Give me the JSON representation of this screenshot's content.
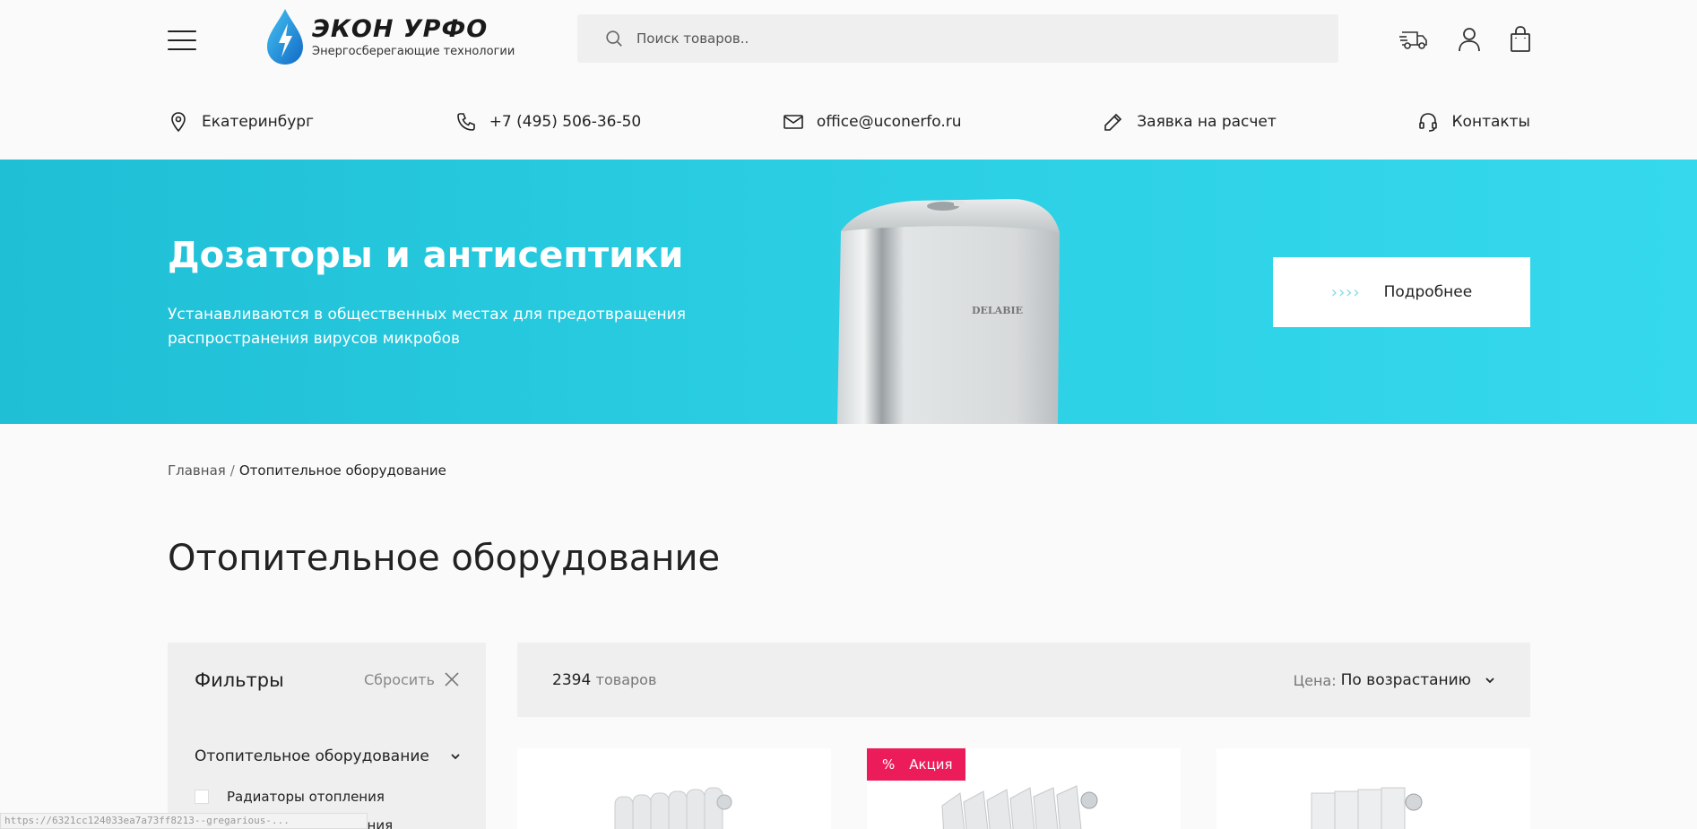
{
  "header": {
    "logo_title": "ЭКОН УРФО",
    "logo_subtitle": "Энергосберегающие технологии",
    "search_placeholder": "Поиск товаров.."
  },
  "contacts": [
    {
      "icon": "location-pin-icon",
      "label": "Екатеринбург"
    },
    {
      "icon": "phone-icon",
      "label": "+7 (495) 506-36-50"
    },
    {
      "icon": "mail-icon",
      "label": "office@uconerfo.ru"
    },
    {
      "icon": "pencil-icon",
      "label": "Заявка на расчет"
    },
    {
      "icon": "headset-icon",
      "label": "Контакты"
    }
  ],
  "banner": {
    "title": "Дозаторы и антисептики",
    "text": "Устанавливаются в общественных местах для предотвращения распространения вирусов микробов",
    "product_brand": "DELABIE",
    "button_arrows": "››››",
    "button_label": "Подробнее",
    "bg_color": "#2cd0e4"
  },
  "breadcrumb": {
    "home": "Главная",
    "separator": "/",
    "current": "Отопительное оборудование"
  },
  "page_title": "Отопительное оборудование",
  "filters": {
    "title": "Фильтры",
    "reset": "Сбросить",
    "category": "Отопительное оборудование",
    "options": [
      "Радиаторы отопления",
      "Конвекторы отопления"
    ]
  },
  "listing": {
    "count": "2394",
    "count_unit": "товаров",
    "sort_label": "Цена:",
    "sort_value": "По возрастанию"
  },
  "products": [
    {
      "badge": ""
    },
    {
      "badge_icon": "%",
      "badge": "Акция",
      "badge_color": "#ec1c5a"
    },
    {
      "badge": ""
    }
  ],
  "status_url": "https://6321cc124033ea7a73ff8213--gregarious-..."
}
